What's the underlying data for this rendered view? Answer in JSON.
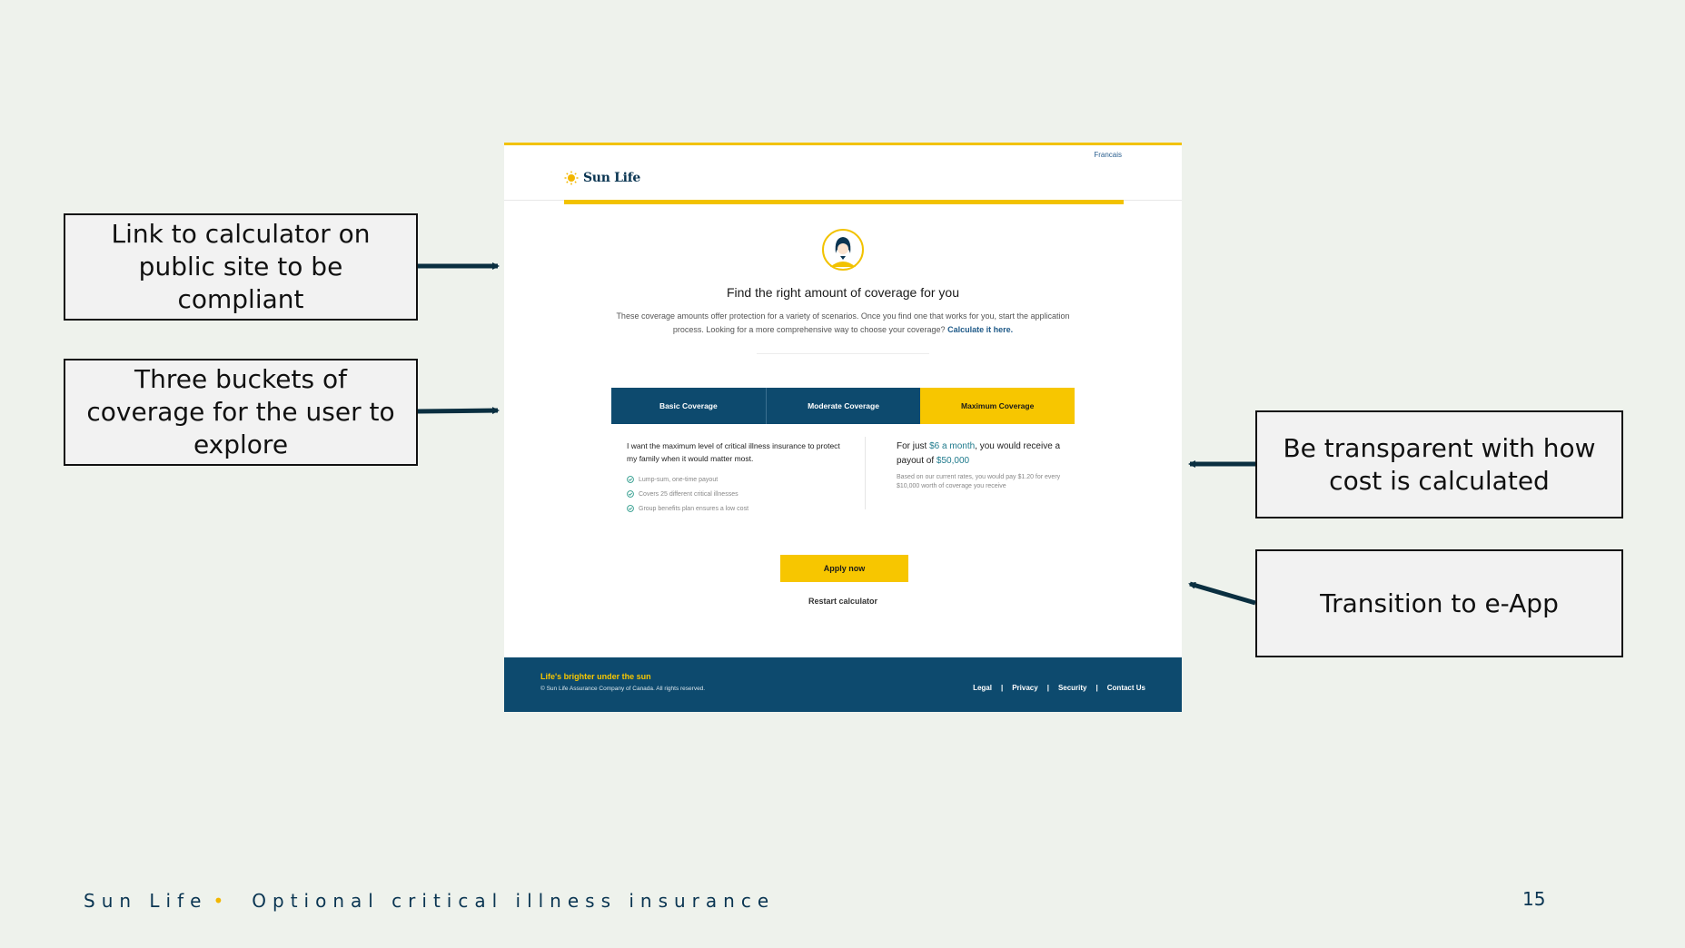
{
  "callouts": {
    "link_calculator": "Link to calculator on public site to be compliant",
    "three_buckets": "Three buckets of coverage for the user to explore",
    "transparent_cost": "Be transparent with how cost is calculated",
    "transition_eapp": "Transition to e-App"
  },
  "mock": {
    "language_link": "Francais",
    "brand": "Sun Life",
    "title": "Find the right amount of coverage for you",
    "description": "These coverage amounts offer protection for a variety of scenarios. Once you find one that works for you, start the application process.  Looking for a more comprehensive way to choose your coverage?",
    "calculate_link": "Calculate it here.",
    "tabs": [
      {
        "label": "Basic Coverage",
        "active": false
      },
      {
        "label": "Moderate Coverage",
        "active": false
      },
      {
        "label": "Maximum Coverage",
        "active": true
      }
    ],
    "lead_text": "I want the maximum level of critical illness insurance to protect my family when it would matter most.",
    "features": [
      "Lump-sum, one-time payout",
      "Covers 25 different critical illnesses",
      "Group benefits plan ensures a low cost"
    ],
    "price": {
      "prefix": "For just ",
      "amount": "$6 a month",
      "middle": ", you would receive a payout of ",
      "payout": "$50,000"
    },
    "price_note": "Based on our current rates, you would pay $1.20 for every $10,000 worth of coverage you receive",
    "apply_button": "Apply now",
    "restart_link": "Restart calculator",
    "footer": {
      "tagline": "Life's brighter under the sun",
      "copyright": "© Sun Life Assurance Company of Canada. All rights reserved.",
      "links": [
        "Legal",
        "Privacy",
        "Security",
        "Contact Us"
      ]
    }
  },
  "slide": {
    "footer_brand": "Sun Life",
    "footer_title": "Optional critical illness insurance",
    "page_number": "15"
  },
  "colors": {
    "navy": "#0d4a6e",
    "yellow": "#f7c600",
    "background": "#eef2ec"
  },
  "icons": [
    "sun-logo-icon",
    "avatar-icon",
    "check-circle-icon",
    "arrow-icon"
  ]
}
